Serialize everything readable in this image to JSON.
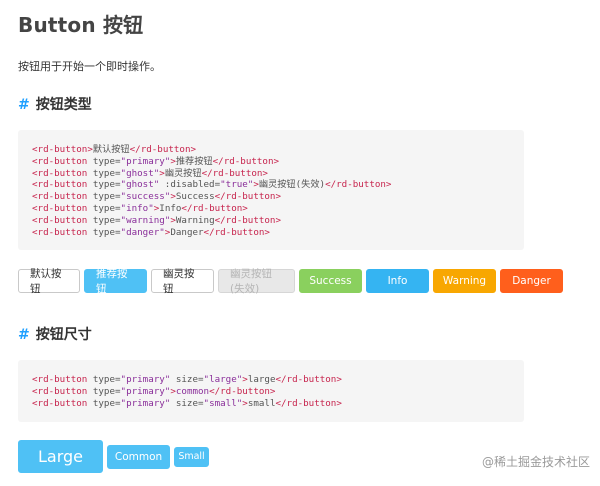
{
  "page": {
    "title": "Button 按钮",
    "description": "按钮用于开始一个即时操作。"
  },
  "sections": {
    "types_heading": "按钮类型",
    "sizes_heading": "按钮尺寸",
    "hash_symbol": "#"
  },
  "code_types": [
    [
      {
        "c": "tag",
        "t": "<rd-button"
      },
      {
        "c": "tag",
        "t": ">"
      },
      {
        "c": "txt",
        "t": "默认按钮"
      },
      {
        "c": "tag",
        "t": "</rd-button>"
      }
    ],
    [
      {
        "c": "tag",
        "t": "<rd-button "
      },
      {
        "c": "attr",
        "t": "type="
      },
      {
        "c": "str",
        "t": "\"primary\""
      },
      {
        "c": "tag",
        "t": ">"
      },
      {
        "c": "txt",
        "t": "推荐按钮"
      },
      {
        "c": "tag",
        "t": "</rd-button>"
      }
    ],
    [
      {
        "c": "tag",
        "t": "<rd-button "
      },
      {
        "c": "attr",
        "t": "type="
      },
      {
        "c": "str",
        "t": "\"ghost\""
      },
      {
        "c": "tag",
        "t": ">"
      },
      {
        "c": "txt",
        "t": "幽灵按钮"
      },
      {
        "c": "tag",
        "t": "</rd-button>"
      }
    ],
    [
      {
        "c": "tag",
        "t": "<rd-button "
      },
      {
        "c": "attr",
        "t": "type="
      },
      {
        "c": "str",
        "t": "\"ghost\""
      },
      {
        "c": "attr",
        "t": " :disabled="
      },
      {
        "c": "str",
        "t": "\"true\""
      },
      {
        "c": "tag",
        "t": ">"
      },
      {
        "c": "txt",
        "t": "幽灵按钮(失效)"
      },
      {
        "c": "tag",
        "t": "</rd-button>"
      }
    ],
    [
      {
        "c": "tag",
        "t": "<rd-button "
      },
      {
        "c": "attr",
        "t": "type="
      },
      {
        "c": "str",
        "t": "\"success\""
      },
      {
        "c": "tag",
        "t": ">"
      },
      {
        "c": "txt",
        "t": "Success"
      },
      {
        "c": "tag",
        "t": "</rd-button>"
      }
    ],
    [
      {
        "c": "tag",
        "t": "<rd-button "
      },
      {
        "c": "attr",
        "t": "type="
      },
      {
        "c": "str",
        "t": "\"info\""
      },
      {
        "c": "tag",
        "t": ">"
      },
      {
        "c": "txt",
        "t": "Info"
      },
      {
        "c": "tag",
        "t": "</rd-button>"
      }
    ],
    [
      {
        "c": "tag",
        "t": "<rd-button "
      },
      {
        "c": "attr",
        "t": "type="
      },
      {
        "c": "str",
        "t": "\"warning\""
      },
      {
        "c": "tag",
        "t": ">"
      },
      {
        "c": "txt",
        "t": "Warning"
      },
      {
        "c": "tag",
        "t": "</rd-button>"
      }
    ],
    [
      {
        "c": "tag",
        "t": "<rd-button "
      },
      {
        "c": "attr",
        "t": "type="
      },
      {
        "c": "str",
        "t": "\"danger\""
      },
      {
        "c": "tag",
        "t": ">"
      },
      {
        "c": "txt",
        "t": "Danger"
      },
      {
        "c": "tag",
        "t": "</rd-button>"
      }
    ]
  ],
  "code_sizes": [
    [
      {
        "c": "tag",
        "t": "<rd-button "
      },
      {
        "c": "attr",
        "t": "type="
      },
      {
        "c": "str",
        "t": "\"primary\""
      },
      {
        "c": "attr",
        "t": " size="
      },
      {
        "c": "str",
        "t": "\"large\""
      },
      {
        "c": "tag",
        "t": ">"
      },
      {
        "c": "txt",
        "t": "large"
      },
      {
        "c": "tag",
        "t": "</rd-button>"
      }
    ],
    [
      {
        "c": "tag",
        "t": "<rd-button "
      },
      {
        "c": "attr",
        "t": "type="
      },
      {
        "c": "str",
        "t": "\"primary\""
      },
      {
        "c": "tag",
        "t": ">"
      },
      {
        "c": "str",
        "t": "common"
      },
      {
        "c": "tag",
        "t": "</rd-button>"
      }
    ],
    [
      {
        "c": "tag",
        "t": "<rd-button "
      },
      {
        "c": "attr",
        "t": "type="
      },
      {
        "c": "str",
        "t": "\"primary\""
      },
      {
        "c": "attr",
        "t": " size="
      },
      {
        "c": "str",
        "t": "\"small\""
      },
      {
        "c": "tag",
        "t": ">"
      },
      {
        "c": "txt",
        "t": "small"
      },
      {
        "c": "tag",
        "t": "</rd-button>"
      }
    ]
  ],
  "type_buttons": {
    "default": "默认按钮",
    "primary": "推荐按钮",
    "ghost": "幽灵按钮",
    "ghost_disabled": "幽灵按钮(失效)",
    "success": "Success",
    "info": "Info",
    "warning": "Warning",
    "danger": "Danger"
  },
  "size_buttons": {
    "large": "Large",
    "common": "Common",
    "small": "Small"
  },
  "watermark": "@稀土掘金技术社区",
  "colors": {
    "accent": "#20a0ff",
    "primary": "#4fc1f5",
    "success": "#8ad05e",
    "info": "#35b4f2",
    "warning": "#f8a701",
    "danger": "#ff5f1c",
    "code_bg": "#f5f5f5",
    "code_tag": "#c7254e",
    "code_string": "#8a2f9a"
  }
}
